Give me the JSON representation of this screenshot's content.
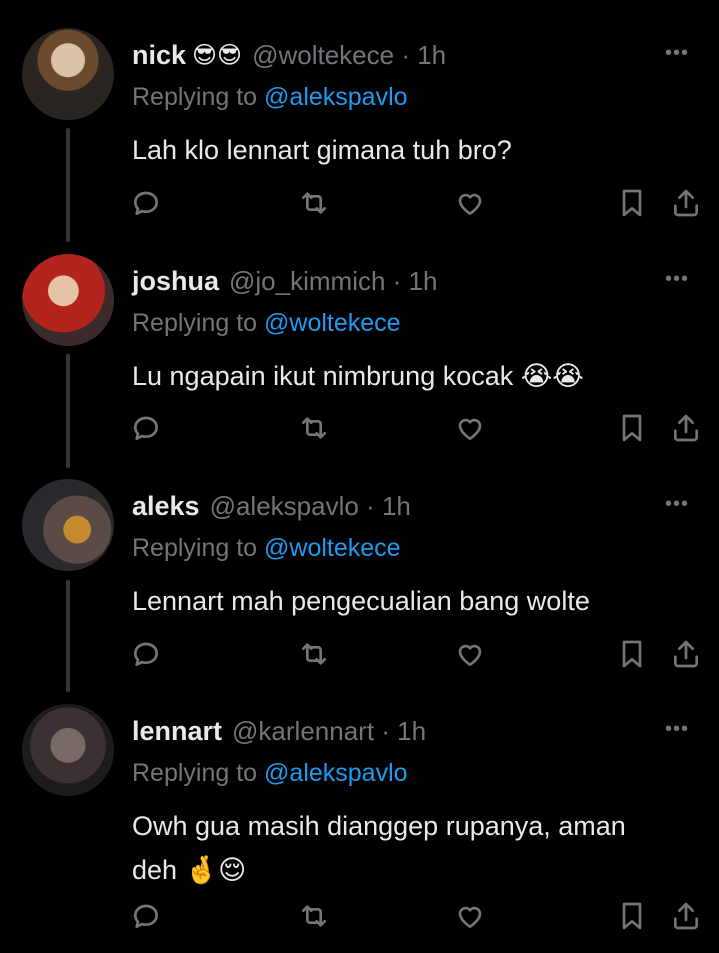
{
  "replying_label": "Replying to ",
  "time_sep": " · ",
  "icons": {
    "reply": "reply-icon",
    "retweet": "retweet-icon",
    "like": "heart-icon",
    "bookmark": "bookmark-icon",
    "share": "share-icon",
    "more": "more-icon"
  },
  "tweets": [
    {
      "name": "nick",
      "emoji": "😎😎",
      "handle": "@woltekece",
      "time": "1h",
      "replying_to": "@alekspavlo",
      "text": "Lah klo lennart gimana tuh bro?"
    },
    {
      "name": "joshua",
      "emoji": "",
      "handle": "@jo_kimmich",
      "time": "1h",
      "replying_to": "@woltekece",
      "text": "Lu ngapain ikut nimbrung kocak 😭😭"
    },
    {
      "name": "aleks",
      "emoji": "",
      "handle": "@alekspavlo",
      "time": "1h",
      "replying_to": "@woltekece",
      "text": "Lennart mah pengecualian bang wolte"
    },
    {
      "name": "lennart",
      "emoji": "",
      "handle": "@karlennart",
      "time": "1h",
      "replying_to": "@alekspavlo",
      "text": "Owh gua masih dianggep rupanya, aman deh 🤞😌"
    }
  ]
}
